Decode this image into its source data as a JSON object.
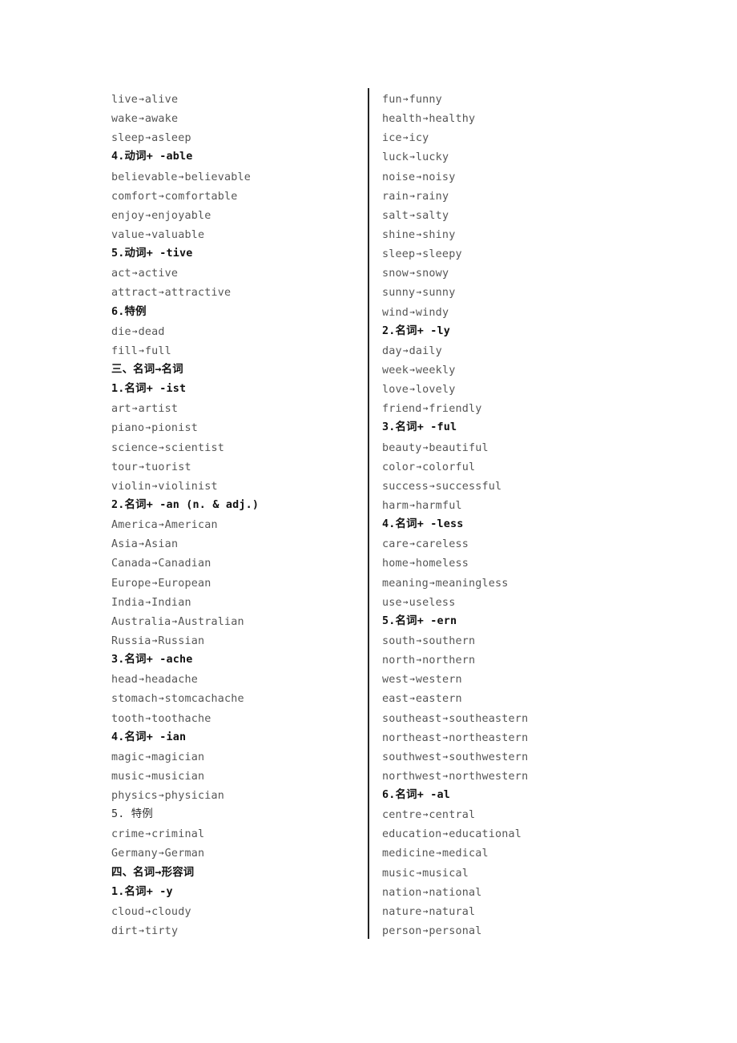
{
  "arrow_glyph": "→",
  "left_column": [
    {
      "type": "entry",
      "from": "live",
      "to": "alive"
    },
    {
      "type": "entry",
      "from": "wake",
      "to": "awake"
    },
    {
      "type": "entry",
      "from": "sleep",
      "to": "asleep"
    },
    {
      "type": "heading",
      "text": "4.动词+ -able"
    },
    {
      "type": "entry",
      "from": "believable",
      "to": "believable"
    },
    {
      "type": "entry",
      "from": "comfort",
      "to": "comfortable"
    },
    {
      "type": "entry",
      "from": "enjoy",
      "to": "enjoyable"
    },
    {
      "type": "entry",
      "from": "value",
      "to": "valuable"
    },
    {
      "type": "heading",
      "text": "5.动词+ -tive"
    },
    {
      "type": "entry",
      "from": "act",
      "to": "active"
    },
    {
      "type": "entry",
      "from": "attract",
      "to": "attractive"
    },
    {
      "type": "heading",
      "text": "6.特例"
    },
    {
      "type": "entry",
      "from": "die",
      "to": "dead"
    },
    {
      "type": "entry",
      "from": "fill",
      "to": "full"
    },
    {
      "type": "heading",
      "text": "三、名词→名词"
    },
    {
      "type": "heading",
      "text": "1.名词+ -ist"
    },
    {
      "type": "entry",
      "from": "art",
      "to": "artist"
    },
    {
      "type": "entry",
      "from": "piano",
      "to": "pionist"
    },
    {
      "type": "entry",
      "from": "science",
      "to": "scientist"
    },
    {
      "type": "entry",
      "from": "tour",
      "to": "tuorist"
    },
    {
      "type": "entry",
      "from": "violin",
      "to": "violinist"
    },
    {
      "type": "heading",
      "text": "2.名词+ -an (n. & adj.)"
    },
    {
      "type": "entry",
      "from": "America",
      "to": "American"
    },
    {
      "type": "entry",
      "from": "Asia",
      "to": "Asian"
    },
    {
      "type": "entry",
      "from": "Canada",
      "to": "Canadian"
    },
    {
      "type": "entry",
      "from": "Europe",
      "to": "European"
    },
    {
      "type": "entry",
      "from": "India",
      "to": "Indian"
    },
    {
      "type": "entry",
      "from": "Australia",
      "to": "Australian"
    },
    {
      "type": "entry",
      "from": "Russia",
      "to": "Russian"
    },
    {
      "type": "heading",
      "text": "3.名词+ -ache"
    },
    {
      "type": "entry",
      "from": "head",
      "to": "headache"
    },
    {
      "type": "entry",
      "from": "stomach",
      "to": "stomcachache"
    },
    {
      "type": "entry",
      "from": "tooth",
      "to": "toothache"
    },
    {
      "type": "heading",
      "text": "4.名词+ -ian"
    },
    {
      "type": "entry",
      "from": "magic",
      "to": "magician"
    },
    {
      "type": "entry",
      "from": "music",
      "to": "musician"
    },
    {
      "type": "entry",
      "from": "physics",
      "to": "physician"
    },
    {
      "type": "heading-plain",
      "text": "5. 特例"
    },
    {
      "type": "entry",
      "from": "crime",
      "to": "criminal"
    },
    {
      "type": "entry",
      "from": "Germany",
      "to": "German"
    },
    {
      "type": "heading",
      "text": "四、名词→形容词"
    },
    {
      "type": "heading",
      "text": "1.名词+ -y"
    },
    {
      "type": "entry",
      "from": "cloud",
      "to": "cloudy"
    },
    {
      "type": "entry",
      "from": "dirt",
      "to": "tirty"
    }
  ],
  "right_column": [
    {
      "type": "entry",
      "from": "fun",
      "to": "funny"
    },
    {
      "type": "entry",
      "from": "health",
      "to": "healthy"
    },
    {
      "type": "entry",
      "from": "ice",
      "to": "icy"
    },
    {
      "type": "entry",
      "from": "luck",
      "to": "lucky"
    },
    {
      "type": "entry",
      "from": "noise",
      "to": "noisy"
    },
    {
      "type": "entry",
      "from": "rain",
      "to": "rainy"
    },
    {
      "type": "entry",
      "from": "salt",
      "to": "salty"
    },
    {
      "type": "entry",
      "from": "shine",
      "to": "shiny"
    },
    {
      "type": "entry",
      "from": "sleep",
      "to": "sleepy"
    },
    {
      "type": "entry",
      "from": "snow",
      "to": "snowy"
    },
    {
      "type": "entry",
      "from": "sunny",
      "to": "sunny"
    },
    {
      "type": "entry",
      "from": "wind",
      "to": "windy"
    },
    {
      "type": "heading",
      "text": "2.名词+ -ly"
    },
    {
      "type": "entry",
      "from": "day",
      "to": "daily"
    },
    {
      "type": "entry",
      "from": "week",
      "to": "weekly"
    },
    {
      "type": "entry",
      "from": "love",
      "to": "lovely"
    },
    {
      "type": "entry",
      "from": "friend",
      "to": "friendly"
    },
    {
      "type": "heading",
      "text": "3.名词+ -ful"
    },
    {
      "type": "entry",
      "from": "beauty",
      "to": "beautiful"
    },
    {
      "type": "entry",
      "from": "color",
      "to": "colorful"
    },
    {
      "type": "entry",
      "from": "success",
      "to": "successful"
    },
    {
      "type": "entry",
      "from": "harm",
      "to": "harmful"
    },
    {
      "type": "heading",
      "text": "4.名词+ -less"
    },
    {
      "type": "entry",
      "from": "care",
      "to": "careless"
    },
    {
      "type": "entry",
      "from": "home",
      "to": "homeless"
    },
    {
      "type": "entry",
      "from": "meaning",
      "to": "meaningless"
    },
    {
      "type": "entry",
      "from": "use",
      "to": "useless"
    },
    {
      "type": "heading",
      "text": "5.名词+ -ern"
    },
    {
      "type": "entry",
      "from": "south",
      "to": "southern"
    },
    {
      "type": "entry",
      "from": "north",
      "to": "northern"
    },
    {
      "type": "entry",
      "from": "west",
      "to": "western"
    },
    {
      "type": "entry",
      "from": "east",
      "to": "eastern"
    },
    {
      "type": "entry",
      "from": "southeast",
      "to": "southeastern"
    },
    {
      "type": "entry",
      "from": "northeast",
      "to": "northeastern"
    },
    {
      "type": "entry",
      "from": "southwest",
      "to": "southwestern"
    },
    {
      "type": "entry",
      "from": "northwest",
      "to": "northwestern"
    },
    {
      "type": "heading",
      "text": "6.名词+ -al"
    },
    {
      "type": "entry",
      "from": "centre",
      "to": "central"
    },
    {
      "type": "entry",
      "from": "education",
      "to": "educational"
    },
    {
      "type": "entry",
      "from": "medicine",
      "to": "medical"
    },
    {
      "type": "entry",
      "from": "music",
      "to": "musical"
    },
    {
      "type": "entry",
      "from": "nation",
      "to": "national"
    },
    {
      "type": "entry",
      "from": "nature",
      "to": "natural"
    },
    {
      "type": "entry",
      "from": "person",
      "to": "personal"
    }
  ]
}
